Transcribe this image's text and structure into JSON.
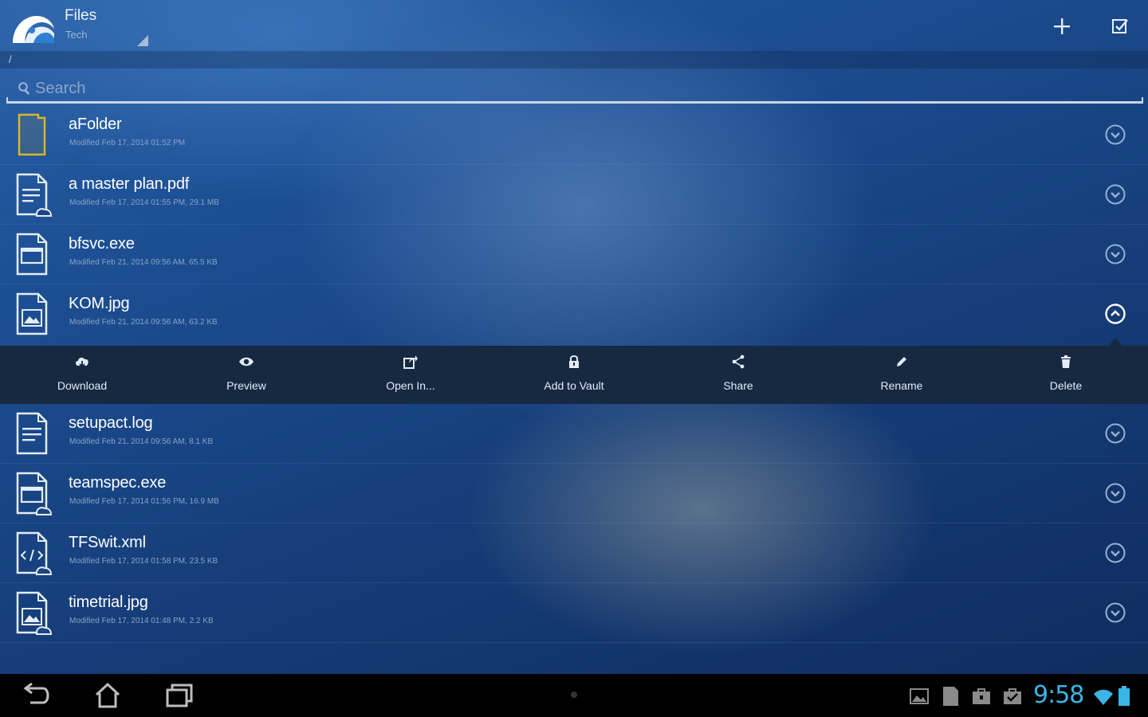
{
  "app": {
    "title": "Files",
    "subtitle": "Tech",
    "path": "/"
  },
  "toolbar": {
    "add_icon": "plus-icon",
    "select_icon": "checkbox-select-icon"
  },
  "search": {
    "placeholder": "Search",
    "value": ""
  },
  "files": [
    {
      "name": "aFolder",
      "meta": "Modified Feb 17, 2014 01:52 PM",
      "icon": "folder-icon",
      "expanded": false
    },
    {
      "name": "a master plan.pdf",
      "meta": "Modified Feb 17, 2014 01:55 PM, 29.1 MB",
      "icon": "document-icon",
      "expanded": false
    },
    {
      "name": "bfsvc.exe",
      "meta": "Modified Feb 21, 2014 09:56 AM, 65.5 KB",
      "icon": "application-icon",
      "expanded": false
    },
    {
      "name": "KOM.jpg",
      "meta": "Modified Feb 21, 2014 09:56 AM, 63.2 KB",
      "icon": "image-icon",
      "expanded": true
    },
    {
      "name": "setupact.log",
      "meta": "Modified Feb 21, 2014 09:56 AM, 8.1 KB",
      "icon": "text-file-icon",
      "expanded": false
    },
    {
      "name": "teamspec.exe",
      "meta": "Modified Feb 17, 2014 01:56 PM, 16.9 MB",
      "icon": "application-icon",
      "expanded": false
    },
    {
      "name": "TFSwit.xml",
      "meta": "Modified Feb 17, 2014 01:58 PM, 23.5 KB",
      "icon": "code-file-icon",
      "expanded": false
    },
    {
      "name": "timetrial.jpg",
      "meta": "Modified Feb 17, 2014 01:48 PM, 2.2 KB",
      "icon": "image-icon",
      "expanded": false
    }
  ],
  "actions": [
    {
      "label": "Download",
      "icon": "cloud-download-icon"
    },
    {
      "label": "Preview",
      "icon": "eye-icon"
    },
    {
      "label": "Open In...",
      "icon": "open-external-icon"
    },
    {
      "label": "Add to Vault",
      "icon": "lock-icon"
    },
    {
      "label": "Share",
      "icon": "share-icon"
    },
    {
      "label": "Rename",
      "icon": "pencil-icon"
    },
    {
      "label": "Delete",
      "icon": "trash-icon"
    }
  ],
  "system": {
    "time": "9:58",
    "clock_color": "#39b6e6"
  },
  "colors": {
    "background": "#1d4f94",
    "action_strip": "#172841",
    "folder_accent": "#d8b52a"
  }
}
